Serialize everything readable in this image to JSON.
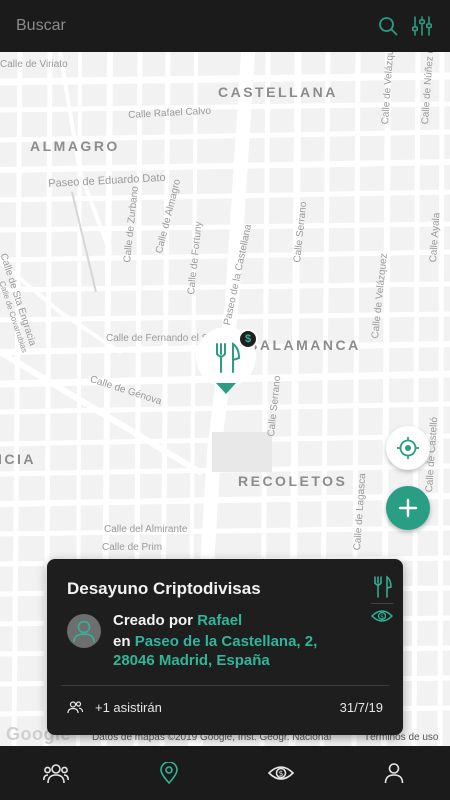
{
  "search": {
    "placeholder": "Buscar",
    "value": ""
  },
  "topbar": {
    "search_icon": "search-icon",
    "filter_icon": "filter-sliders-icon"
  },
  "map": {
    "districts": [
      "CASTELLANA",
      "ALMAGRO",
      "SALAMANCA",
      "RECOLETOS",
      "ICIA"
    ],
    "streets": [
      "Calle de Viriato",
      "Calle Rafael Calvo",
      "Paseo de Eduardo Dato",
      "Calle de Zurbano",
      "Calle de Almagro",
      "Calle de Fortuny",
      "Paseo de la Castellana",
      "Calle Serrano",
      "Calle de Velázquez",
      "Calle de Sta Engracia",
      "Calle de Covarrubias",
      "Calle de Fernando el Santo",
      "Calle de Génova",
      "Calle del Almirante",
      "Calle de Prim",
      "Calle Serrano",
      "Calle de Lagasca",
      "Calle de Núñez de Ba",
      "Calle de Velázquez",
      "Calle de Castelló",
      "Calle Ayala"
    ],
    "marker_category": "fork-knife-icon",
    "marker_badge": "$",
    "attribution": "Datos de mapas ©2019 Google, Inst. Geogr. Nacional",
    "terms": "Términos de uso",
    "google_logo": "Google"
  },
  "card": {
    "title": "Desayuno Criptodivisas",
    "created_prefix": "Creado por",
    "creator": "Rafael",
    "location_prefix": "en",
    "location": "Paseo de la Castellana, 2, 28046 Madrid, España",
    "attendees": "+1 asistirán",
    "date": "31/7/19"
  },
  "nav": {
    "items": [
      "people-icon",
      "map-pin-icon",
      "eye-dollar-icon",
      "profile-icon"
    ],
    "active_index": 1
  },
  "colors": {
    "accent": "#2a9d85",
    "accent_text": "#2fb59a",
    "dark": "#1b1b1b",
    "map_bg": "#f2f2f2"
  }
}
